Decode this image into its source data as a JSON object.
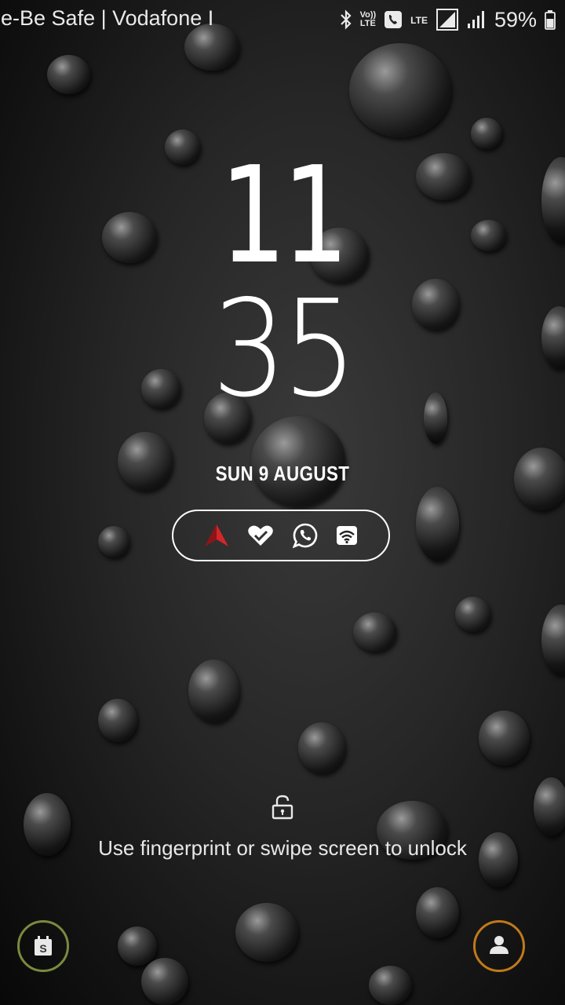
{
  "status_bar": {
    "carrier": "ne-Be Safe | Vodafone I",
    "volte": "Vo))",
    "lte_small": "LTE",
    "lte": "LTE",
    "battery_percent": "59%",
    "icons": [
      "bluetooth-icon",
      "volte-icon",
      "call-icon",
      "lte-icon",
      "signal-icon",
      "signal-icon-2",
      "battery-icon"
    ]
  },
  "clock": {
    "hours": "11",
    "minutes": "35"
  },
  "date": "SUN 9 AUGUST",
  "notifications": {
    "icons": [
      "arrow-app-icon",
      "heart-check-icon",
      "whatsapp-icon",
      "wifi-icon"
    ],
    "arrow_color": "#d3262b"
  },
  "unlock": {
    "hint": "Use fingerprint or swipe screen to unlock"
  },
  "shortcuts": {
    "left_icon": "s-planner-icon",
    "left_label": "S",
    "right_icon": "contact-icon",
    "left_ring_color": "#7a8a3e",
    "right_ring_color": "#c07a1a"
  }
}
